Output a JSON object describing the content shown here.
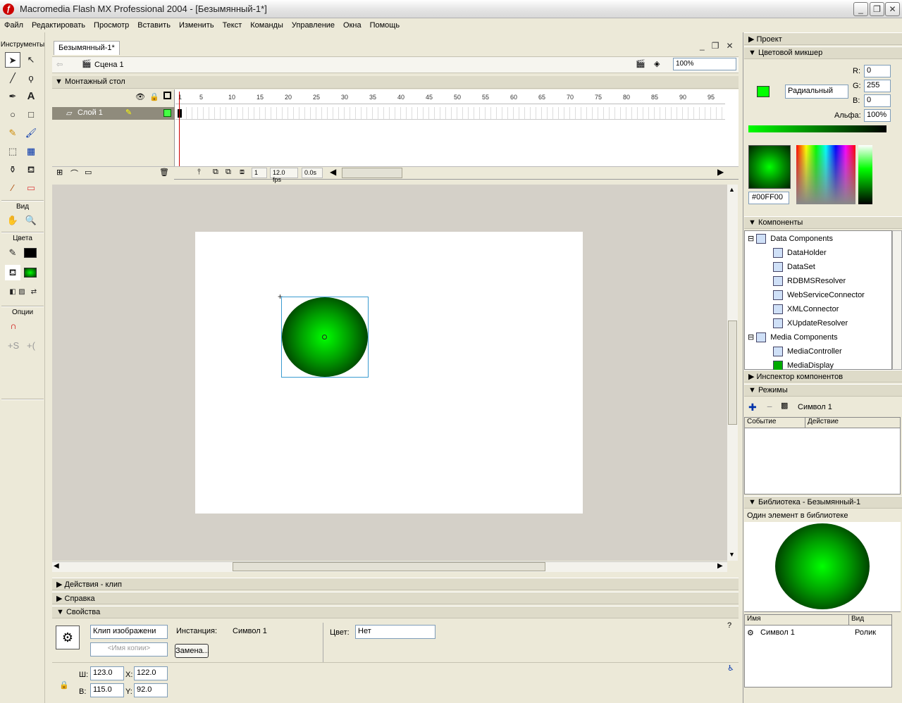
{
  "app": {
    "title": "Macromedia Flash MX Professional 2004 - [Безымянный-1*]"
  },
  "menu": [
    "Файл",
    "Редактировать",
    "Просмотр",
    "Вставить",
    "Изменить",
    "Текст",
    "Команды",
    "Управление",
    "Окна",
    "Помощь"
  ],
  "tools": {
    "header": "Инструменты",
    "view_label": "Вид",
    "colors_label": "Цвета",
    "options_label": "Опции"
  },
  "document": {
    "tab": "Безымянный-1*",
    "scene": "Сцена 1",
    "zoom": "100%"
  },
  "timeline": {
    "header": "Монтажный стол",
    "layer": "Слой 1",
    "ticks": [
      "1",
      "5",
      "10",
      "15",
      "20",
      "25",
      "30",
      "35",
      "40",
      "45",
      "50",
      "55",
      "60",
      "65",
      "70",
      "75",
      "80",
      "85",
      "90",
      "95"
    ],
    "frame": "1",
    "fps": "12.0 fps",
    "time": "0.0s"
  },
  "panels": {
    "actions": "Действия - клип",
    "help": "Справка",
    "properties": "Свойства"
  },
  "properties": {
    "type": "Клип изображени",
    "instance_placeholder": "<Имя копии>",
    "instance_label": "Инстанция:",
    "instance_value": "Символ 1",
    "swap": "Замена...",
    "color_label": "Цвет:",
    "color_value": "Нет",
    "w_label": "Ш:",
    "w": "123.0",
    "h_label": "В:",
    "h": "115.0",
    "x_label": "X:",
    "x": "122.0",
    "y_label": "Y:",
    "y": "92.0"
  },
  "right": {
    "project": "Проект",
    "mixer": "Цветовой микшер",
    "fill_type": "Радиальный",
    "r_label": "R:",
    "r": "0",
    "g_label": "G:",
    "g": "255",
    "b_label": "B:",
    "b": "0",
    "alpha_label": "Альфа:",
    "alpha": "100%",
    "hex": "#00FF00",
    "components": "Компоненты",
    "comp_items": [
      "Data Components",
      "DataHolder",
      "DataSet",
      "RDBMSResolver",
      "WebServiceConnector",
      "XMLConnector",
      "XUpdateResolver",
      "Media Components",
      "MediaController",
      "MediaDisplay"
    ],
    "inspector": "Инспектор компонентов",
    "behaviors": "Режимы",
    "behaviors_symbol": "Символ 1",
    "event_col": "Событие",
    "action_col": "Действие",
    "library": "Библиотека - Безымянный-1",
    "library_count": "Один элемент в библиотеке",
    "lib_name_col": "Имя",
    "lib_kind_col": "Вид",
    "lib_item_name": "Символ 1",
    "lib_item_kind": "Ролик"
  },
  "colors": {
    "accent": "#00ff00",
    "stage_bg": "#d4d0c8",
    "selection": "#3a9bd0"
  }
}
